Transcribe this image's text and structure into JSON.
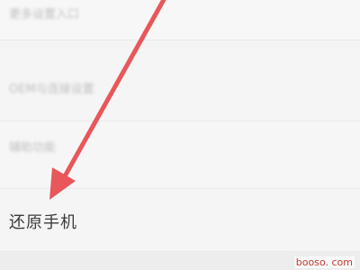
{
  "settings": {
    "items": [
      {
        "label": "更多设置入口"
      },
      {
        "label": "OEM与连接设置"
      },
      {
        "label": "辅助功能"
      },
      {
        "label": "还原手机"
      }
    ]
  },
  "watermark": {
    "text": "booso. com"
  },
  "colors": {
    "arrow": "#e8575a",
    "background": "#f4f4f4",
    "text": "#3a3a3a"
  },
  "annotation": {
    "arrow_icon": "red-pointer-arrow-icon"
  }
}
